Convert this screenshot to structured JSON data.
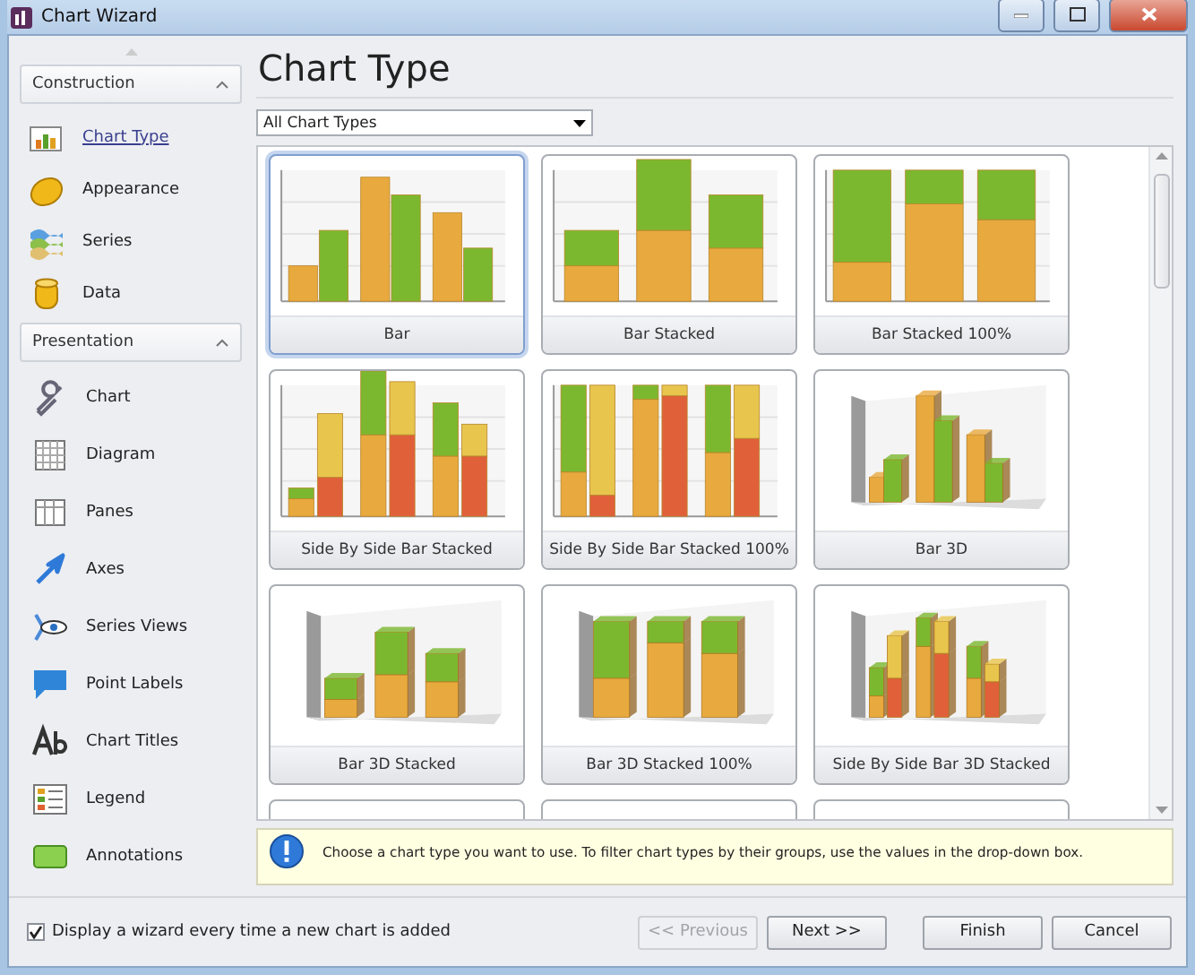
{
  "window": {
    "title": "Chart Wizard"
  },
  "sidebar": {
    "groups": [
      {
        "title": "Construction",
        "expanded": true,
        "items": [
          {
            "label": "Chart Type",
            "selected": true
          },
          {
            "label": "Appearance",
            "selected": false
          },
          {
            "label": "Series",
            "selected": false
          },
          {
            "label": "Data",
            "selected": false
          }
        ]
      },
      {
        "title": "Presentation",
        "expanded": true,
        "items": [
          {
            "label": "Chart",
            "selected": false
          },
          {
            "label": "Diagram",
            "selected": false
          },
          {
            "label": "Panes",
            "selected": false
          },
          {
            "label": "Axes",
            "selected": false
          },
          {
            "label": "Series Views",
            "selected": false
          },
          {
            "label": "Point Labels",
            "selected": false
          },
          {
            "label": "Chart Titles",
            "selected": false
          },
          {
            "label": "Legend",
            "selected": false
          },
          {
            "label": "Annotations",
            "selected": false
          }
        ]
      }
    ]
  },
  "page": {
    "title": "Chart Type",
    "filter": {
      "value": "All Chart Types"
    }
  },
  "gallery": {
    "items": [
      {
        "label": "Bar",
        "kind": "bar",
        "selected": true
      },
      {
        "label": "Bar Stacked",
        "kind": "bar_stacked",
        "selected": false
      },
      {
        "label": "Bar Stacked 100%",
        "kind": "bar_stacked_100",
        "selected": false
      },
      {
        "label": "Side By Side Bar Stacked",
        "kind": "side_by_side_stacked",
        "selected": false
      },
      {
        "label": "Side By Side Bar Stacked 100%",
        "kind": "side_by_side_stacked_100",
        "selected": false
      },
      {
        "label": "Bar 3D",
        "kind": "bar_3d",
        "selected": false
      },
      {
        "label": "Bar 3D Stacked",
        "kind": "bar_3d_stacked",
        "selected": false
      },
      {
        "label": "Bar 3D Stacked 100%",
        "kind": "bar_3d_stacked_100",
        "selected": false
      },
      {
        "label": "Side By Side Bar 3D Stacked",
        "kind": "side_by_side_3d_stacked",
        "selected": false
      },
      {
        "kind": "partial",
        "selected": false
      },
      {
        "kind": "partial",
        "selected": false
      },
      {
        "kind": "partial",
        "selected": false
      }
    ]
  },
  "hint": {
    "text": "Choose a chart type you want to use. To filter chart types by their groups, use the values in the drop-down box."
  },
  "footer": {
    "checkbox": {
      "label": "Display a wizard every time a new chart is added",
      "checked": true
    },
    "buttons": [
      {
        "label": "<< Previous",
        "disabled": true
      },
      {
        "label": "Next >>",
        "disabled": false
      },
      {
        "label": "Finish",
        "disabled": false
      },
      {
        "label": "Cancel",
        "disabled": false
      }
    ]
  }
}
